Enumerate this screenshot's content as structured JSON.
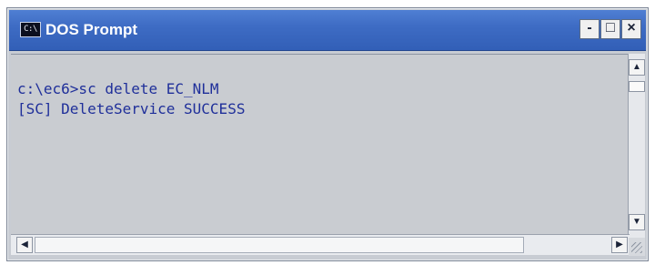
{
  "window": {
    "title": "DOS Prompt",
    "icon_label": "C:\\",
    "icon": "console-icon",
    "controls": {
      "minimize": "-",
      "maximize": "□",
      "close": "×"
    }
  },
  "console": {
    "lines": [
      "c:\\ec6>sc delete EC_NLM",
      "[SC] DeleteService SUCCESS"
    ]
  },
  "scrollbars": {
    "up": "▲",
    "down": "▼",
    "left": "◀",
    "right": "▶"
  },
  "colors": {
    "titlebar": "#3e6cc4",
    "console_text": "#1f2f9a",
    "console_bg": "#c9ccd1"
  }
}
